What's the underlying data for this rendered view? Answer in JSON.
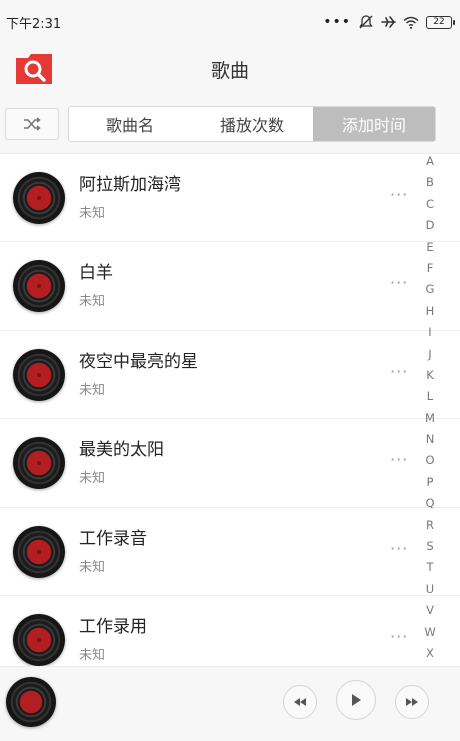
{
  "status_bar": {
    "time": "下午2:31",
    "battery": "22"
  },
  "header": {
    "title": "歌曲"
  },
  "sort_tabs": [
    {
      "label": "歌曲名",
      "active": false
    },
    {
      "label": "播放次数",
      "active": false
    },
    {
      "label": "添加时间",
      "active": true
    }
  ],
  "songs": [
    {
      "title": "阿拉斯加海湾",
      "artist": "未知"
    },
    {
      "title": "白羊",
      "artist": "未知"
    },
    {
      "title": "夜空中最亮的星",
      "artist": "未知"
    },
    {
      "title": "最美的太阳",
      "artist": "未知"
    },
    {
      "title": "工作录音",
      "artist": "未知"
    },
    {
      "title": "工作录用",
      "artist": "未知"
    }
  ],
  "alpha_index": [
    "A",
    "B",
    "C",
    "D",
    "E",
    "F",
    "G",
    "H",
    "I",
    "J",
    "K",
    "L",
    "M",
    "N",
    "O",
    "P",
    "Q",
    "R",
    "S",
    "T",
    "U",
    "V",
    "W",
    "X"
  ],
  "icons": {
    "logo": "search-folder-icon",
    "shuffle": "shuffle-icon",
    "more": "more-dots-icon",
    "prev": "rewind-icon",
    "play": "play-icon",
    "next": "fast-forward-icon"
  },
  "colors": {
    "accent": "#e53935",
    "active_tab": "#bdbdbd",
    "disc_label": "#b21e22"
  }
}
